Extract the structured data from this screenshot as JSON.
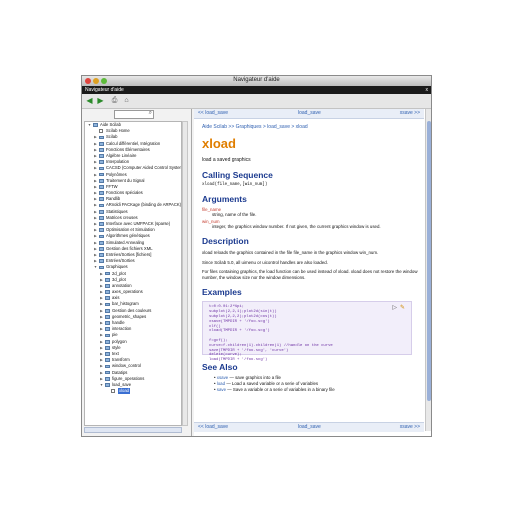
{
  "window": {
    "title": "Navigateur d'aide"
  },
  "menubar": {
    "label": "Navigateur d'aide",
    "close": "x"
  },
  "toolbar": {
    "back": "◀",
    "forward": "▶",
    "print": "⎙",
    "home": "⌂"
  },
  "search": {
    "icon": "search-icon"
  },
  "tree": [
    {
      "label": "Aide Scilab",
      "level": 0,
      "kind": "folder",
      "open": true
    },
    {
      "label": "Scilab Home",
      "level": 1,
      "kind": "page"
    },
    {
      "label": "Scilab",
      "level": 1,
      "kind": "folder"
    },
    {
      "label": "Calcul différentiel, Intégration",
      "level": 1,
      "kind": "folder"
    },
    {
      "label": "Fonctions Élémentaires",
      "level": 1,
      "kind": "folder"
    },
    {
      "label": "Algèbre Linéaire",
      "level": 1,
      "kind": "folder"
    },
    {
      "label": "Interpolation",
      "level": 1,
      "kind": "folder"
    },
    {
      "label": "CACSD (Computer Aided Control Systems)",
      "level": 1,
      "kind": "folder"
    },
    {
      "label": "Polynômes",
      "level": 1,
      "kind": "folder"
    },
    {
      "label": "Traitement du Signal",
      "level": 1,
      "kind": "folder"
    },
    {
      "label": "FFTW",
      "level": 1,
      "kind": "folder"
    },
    {
      "label": "Fonctions spéciales",
      "level": 1,
      "kind": "folder"
    },
    {
      "label": "Randlib",
      "level": 1,
      "kind": "folder"
    },
    {
      "label": "ARnoldi PACKage (binding de ARPACK)",
      "level": 1,
      "kind": "folder"
    },
    {
      "label": "Statistiques",
      "level": 1,
      "kind": "folder"
    },
    {
      "label": "Matrices creuses",
      "level": 1,
      "kind": "folder"
    },
    {
      "label": "Interface avec UMFPACK (sparse)",
      "level": 1,
      "kind": "folder"
    },
    {
      "label": "Optimisation et Simulation",
      "level": 1,
      "kind": "folder"
    },
    {
      "label": "Algorithmes génétiques",
      "level": 1,
      "kind": "folder"
    },
    {
      "label": "Simulated Annealing",
      "level": 1,
      "kind": "folder"
    },
    {
      "label": "Gestion des fichiers XML",
      "level": 1,
      "kind": "folder"
    },
    {
      "label": "Entrées/Sorties [fichiers]",
      "level": 1,
      "kind": "folder"
    },
    {
      "label": "Entrées/Sorties",
      "level": 1,
      "kind": "folder"
    },
    {
      "label": "Graphiques",
      "level": 1,
      "kind": "folder",
      "open": true
    },
    {
      "label": "2d_plot",
      "level": 2,
      "kind": "folder"
    },
    {
      "label": "3d_plot",
      "level": 2,
      "kind": "folder"
    },
    {
      "label": "annotation",
      "level": 2,
      "kind": "folder"
    },
    {
      "label": "axes_operations",
      "level": 2,
      "kind": "folder"
    },
    {
      "label": "axis",
      "level": 2,
      "kind": "folder"
    },
    {
      "label": "bar_histogram",
      "level": 2,
      "kind": "folder"
    },
    {
      "label": "Gestion des couleurs",
      "level": 2,
      "kind": "folder"
    },
    {
      "label": "geometric_shapes",
      "level": 2,
      "kind": "folder"
    },
    {
      "label": "handle",
      "level": 2,
      "kind": "folder"
    },
    {
      "label": "interaction",
      "level": 2,
      "kind": "folder"
    },
    {
      "label": "pie",
      "level": 2,
      "kind": "folder"
    },
    {
      "label": "polygon",
      "level": 2,
      "kind": "folder"
    },
    {
      "label": "style",
      "level": 2,
      "kind": "folder"
    },
    {
      "label": "text",
      "level": 2,
      "kind": "folder"
    },
    {
      "label": "transform",
      "level": 2,
      "kind": "folder"
    },
    {
      "label": "window_control",
      "level": 2,
      "kind": "folder"
    },
    {
      "label": "Datatips",
      "level": 2,
      "kind": "folder"
    },
    {
      "label": "figure_operations",
      "level": 2,
      "kind": "folder"
    },
    {
      "label": "load_save",
      "level": 2,
      "kind": "folder",
      "open": true
    },
    {
      "label": "xload",
      "level": 3,
      "kind": "page",
      "selected": true
    }
  ],
  "nav": {
    "prev": "<< load_save",
    "up": "load_save",
    "next": "xsave >>"
  },
  "page": {
    "breadcrumb": "Aide Scilab >> Graphiques > load_save > xload",
    "title": "xload",
    "short": "load a saved graphics",
    "h_calling": "Calling Sequence",
    "calling": "xload(file_name,[win_num])",
    "h_args": "Arguments",
    "args": [
      {
        "name": "file_name",
        "desc": "string, name of the file."
      },
      {
        "name": "win_num",
        "desc": "integer, the graphics window number. If not given, the current graphics window is used."
      }
    ],
    "h_desc": "Description",
    "desc1": "xload reloads the graphics contained in the file file_name in the graphics window win_num.",
    "desc2": "Since Scilab 5.0, all uimenu or uicontrol handles are also loaded.",
    "desc3": "For files containing graphics, the load function can be used instead of xload. xload does not restore the window number, the window size nor the window dimensions.",
    "h_examples": "Examples",
    "code": [
      "t=0:0.01:2*%pi;",
      "subplot(2,2,1);plot2d(sin(t))",
      "subplot(2,2,2);plot2d(cos(t))",
      "xsave(TMPDIR + '/foo.scg')",
      "clf()",
      "xload(TMPDIR + '/foo.scg')",
      "",
      "f=gcf();",
      "curve=f.children(1).children(1) //handle on the curve",
      "save(TMPDIR + '/foo.scg', 'curve')",
      "delete(curve);",
      "load(TMPDIR + '/foo.scg')"
    ],
    "h_seealso": "See Also",
    "seealso": [
      {
        "link": "xsave",
        "desc": "— save graphics into a file"
      },
      {
        "link": "load",
        "desc": "— Load a saved variable or a serie of variables"
      },
      {
        "link": "save",
        "desc": "— Save a variable or a serie of variables in a binary file"
      }
    ]
  }
}
